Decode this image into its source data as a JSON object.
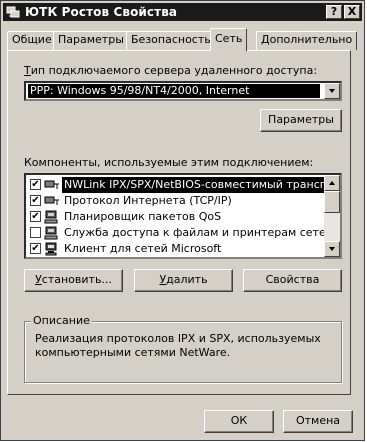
{
  "window": {
    "title": "ЮТК Ростов Свойства",
    "help_label": "?",
    "close_label": "X"
  },
  "tabs": [
    {
      "label": "Общие"
    },
    {
      "label": "Параметры"
    },
    {
      "label": "Безопасность"
    },
    {
      "label": "Сеть"
    },
    {
      "label": "Дополнительно"
    }
  ],
  "server_type": {
    "label_pre": "Т",
    "label_rest": "ип подключаемого сервера удаленного доступа:",
    "selected": "PPP: Windows 95/98/NT4/2000, Internet",
    "settings_button": "Параметры"
  },
  "components": {
    "label": "Компоненты, используемые этим подключением:",
    "items": [
      {
        "label": "NWLink IPX/SPX/NetBIOS-совместимый транспо...",
        "checked": "✔",
        "icon": "network-protocol-icon"
      },
      {
        "label": "Протокол Интернета (TCP/IP)",
        "checked": "✔",
        "icon": "network-protocol-icon"
      },
      {
        "label": "Планировщик пакетов QoS",
        "checked": "✔",
        "icon": "service-computer-icon"
      },
      {
        "label": "Служба доступа к файлам и принтерам сетей Micr...",
        "checked": "",
        "icon": "service-computer-icon"
      },
      {
        "label": "Клиент для сетей Microsoft",
        "checked": "✔",
        "icon": "client-computer-icon"
      }
    ]
  },
  "actions": {
    "install_pre": "У",
    "install_rest": "становить...",
    "remove_pre": "У",
    "remove_rest": "далить",
    "properties_label": "Свойства"
  },
  "description": {
    "legend": "Описание",
    "text": "Реализация протоколов IPX и SPX, используемых компьютерными сетями NetWare."
  },
  "footer": {
    "ok_label": "ОК",
    "cancel_label": "Отмена"
  }
}
